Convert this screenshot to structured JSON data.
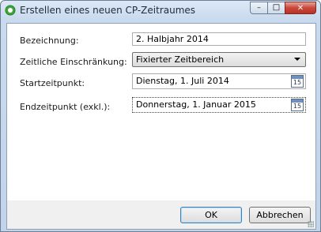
{
  "window": {
    "title": "Erstellen eines neuen CP-Zeitraumes",
    "controls": {
      "minimize": "–",
      "maximize": "□",
      "close": "✕"
    }
  },
  "form": {
    "name_label": "Bezeichnung:",
    "name_value": "2. Halbjahr 2014",
    "restriction_label": "Zeitliche Einschränkung:",
    "restriction_value": "Fixierter Zeitbereich",
    "start_label": "Startzeitpunkt:",
    "start_value": "Dienstag, 1. Juli 2014",
    "end_label": "Endzeitpunkt (exkl.):",
    "end_value": "Donnerstag, 1. Januar 2015",
    "calendar_day": "15"
  },
  "buttons": {
    "ok": "OK",
    "cancel": "Abbrechen"
  },
  "colors": {
    "accent": "#3c7fb1",
    "title_bar": "#c9daee",
    "close_button": "#c9473a"
  },
  "icons": {
    "app": "green-ring-icon",
    "calendar": "calendar-icon"
  }
}
